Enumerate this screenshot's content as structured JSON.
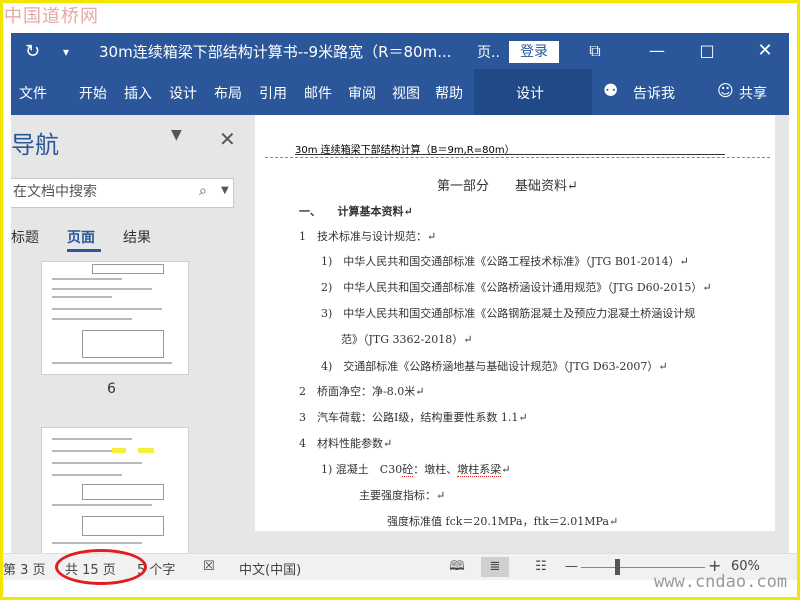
{
  "watermark_top": "中国道桥网",
  "watermark_bottom": "www.cndao.com",
  "titlebar": {
    "autosave_icon": "refresh-icon",
    "customize_icon": "quick-access-dropdown-icon",
    "doc_title": "30m连续箱梁下部结构计算书--9米路宽（R＝80m...",
    "ribbon_option": "页..",
    "login_label": "登录",
    "colors": {
      "bar": "#2b579a"
    }
  },
  "menu": {
    "tabs": [
      "文件",
      "开始",
      "插入",
      "设计",
      "布局",
      "引用",
      "邮件",
      "审阅",
      "视图",
      "帮助"
    ],
    "context_tab": "设计",
    "tell_me": "告诉我",
    "share": "共享"
  },
  "nav": {
    "title": "导航",
    "search_placeholder": "在文档中搜索",
    "tabs": [
      "标题",
      "页面",
      "结果"
    ],
    "active_tab": "页面",
    "thumb_page_number": "6"
  },
  "document": {
    "header": "30m 连续箱梁下部结构计算（B＝9m,R=80m）",
    "lines": [
      "第一部分　　基础资料↵",
      "一、　　计算基本资料↵",
      "1　技术标准与设计规范：↵",
      "1)　中华人民共和国交通部标准《公路工程技术标准》（JTG B01-2014）↵",
      "2)　中华人民共和国交通部标准《公路桥涵设计通用规范》（JTG D60-2015）↵",
      "3)　中华人民共和国交通部标准《公路钢筋混凝土及预应力混凝土桥涵设计规",
      "范》（JTG 3362-2018）↵",
      "4)　交通部标准《公路桥涵地基与基础设计规范》（JTG D63-2007）↵",
      "2　桥面净空：净-8.0米↵",
      "3　汽车荷载：公路Ⅰ级，结构重要性系数 1.1↵",
      "4　材料性能参数↵"
    ],
    "concrete_prefix": "1) 混凝土　C30",
    "concrete_s1": "砼",
    "concrete_mid": "：墩柱、",
    "concrete_s2": "墩柱系梁",
    "concrete_end": "↵",
    "strength_heading": "主要强度指标：↵",
    "strength_values": "强度标准值 fck＝20.1MPa，ftk＝2.01MPa↵"
  },
  "status": {
    "page": "第 3 页",
    "total": "共 15 页",
    "words": "5 个字",
    "language": "中文(中国)",
    "zoom": "60%",
    "zoom_fraction": 0.6
  },
  "annotation_color": "#e01e1e"
}
